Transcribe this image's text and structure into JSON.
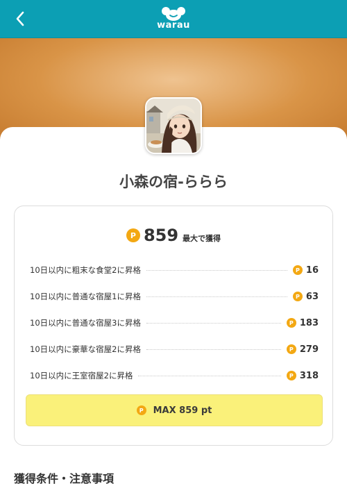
{
  "header": {
    "logo_text": "warau",
    "back_icon": "chevron-left-icon",
    "background_color": "#0c9fb4"
  },
  "offer": {
    "title": "小森の宿-ららら",
    "coin_symbol": "P",
    "total_points": "859",
    "total_suffix": "最大で獲得",
    "rows": [
      {
        "label": "10日以内に粗末な食堂2に昇格",
        "points": "16"
      },
      {
        "label": "10日以内に普通な宿屋1に昇格",
        "points": "63"
      },
      {
        "label": "10日以内に普通な宿屋3に昇格",
        "points": "183"
      },
      {
        "label": "10日以内に豪華な宿屋2に昇格",
        "points": "279"
      },
      {
        "label": "10日以内に王室宿屋2に昇格",
        "points": "318"
      }
    ],
    "max_button_label": "MAX 859 pt"
  },
  "section": {
    "title": "獲得条件・注意事項"
  },
  "colors": {
    "coin": "#f3a813",
    "max_button": "#faf17a",
    "hero": "#d99447"
  }
}
